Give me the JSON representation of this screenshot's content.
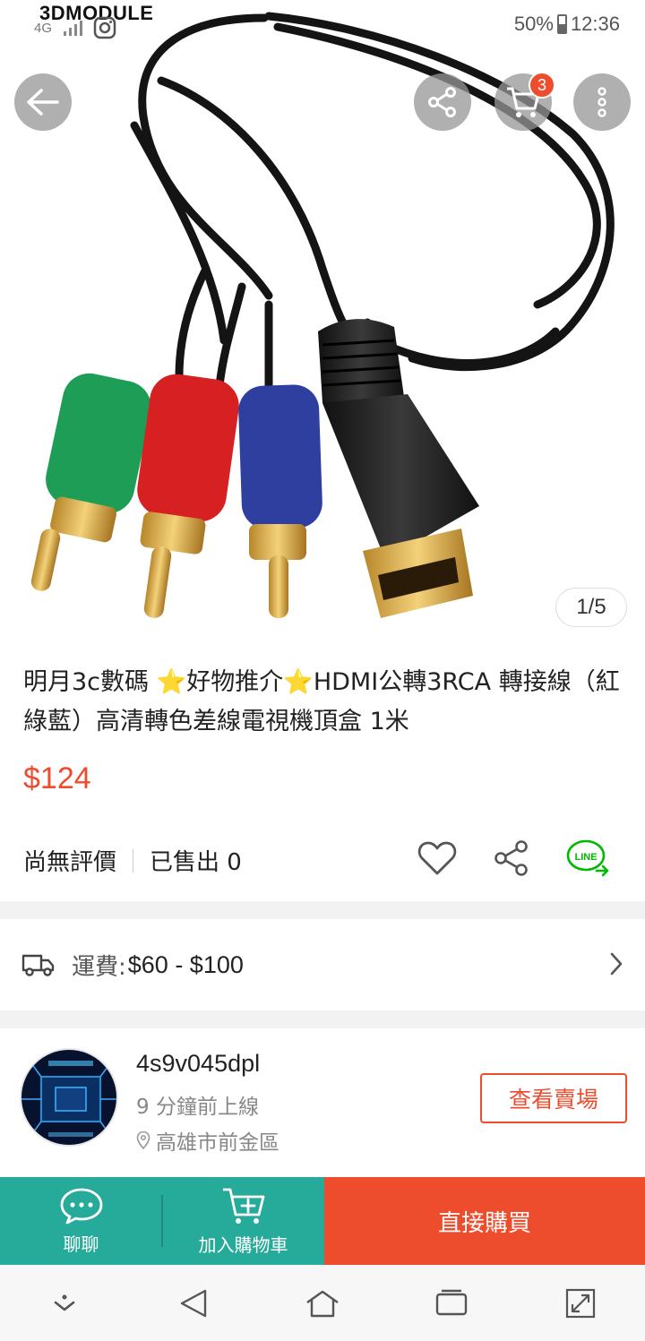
{
  "status_bar": {
    "brand": "3DMODULE",
    "network": "4G",
    "battery": "50%",
    "time": "12:36"
  },
  "gallery": {
    "current": 1,
    "total": 5,
    "pager_text": "1/5",
    "cart_count": "3"
  },
  "product": {
    "title": "明月3c數碼 ⭐好物推介⭐HDMI公轉3RCA 轉接線（紅綠藍）高清轉色差線電視機頂盒 1米",
    "price": "$124",
    "rating_text": "尚無評價",
    "sold_text": "已售出 0"
  },
  "shipping": {
    "label": "運費:",
    "value": "$60 - $100"
  },
  "seller": {
    "name": "4s9v045dpl",
    "online": "9 分鐘前上線",
    "location": "高雄市前金區",
    "shop_button": "查看賣場"
  },
  "action_bar": {
    "chat_label": "聊聊",
    "add_to_cart_label": "加入購物車",
    "buy_now_label": "直接購買"
  },
  "colors": {
    "accent": "#ee4d2d",
    "teal": "#26aa99",
    "line_green": "#00b900"
  }
}
